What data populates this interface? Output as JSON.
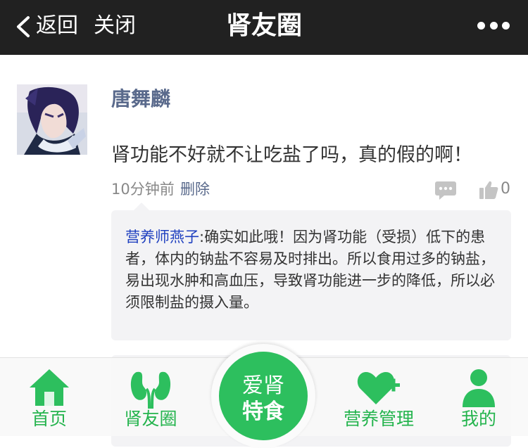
{
  "nav": {
    "back_label": "返回",
    "close_label": "关闭",
    "title": "肾友圈"
  },
  "post": {
    "author": "唐舞麟",
    "text": "肾功能不好就不让吃盐了吗，真的假的啊！",
    "time": "10分钟前",
    "delete_label": "删除",
    "like_count": "0"
  },
  "comments": [
    {
      "author": "营养师燕子",
      "separator": ":",
      "text": "确实如此哦！因为肾功能（受损）低下的患者，体内的钠盐不容易及时排出。所以食用过多的钠盐，易出现水肿和高血压，导致肾功能进一步的降低，所以必须限制盐的摄入量。"
    }
  ],
  "tabs": [
    {
      "label": "首页",
      "icon": "home-icon"
    },
    {
      "label": "肾友圈",
      "icon": "kidney-icon"
    },
    {
      "label": "营养管理",
      "icon": "heart-plus-icon"
    },
    {
      "label": "我的",
      "icon": "user-icon"
    }
  ],
  "center_button": {
    "line1": "爱肾",
    "line2": "特食"
  },
  "colors": {
    "topbar": "#212121",
    "accent_green": "#2dbf5e",
    "tab_green": "#25b44e",
    "author_blue_gray": "#5a6a8c",
    "commenter_blue": "#1e3fbf",
    "comment_bg": "#f3f3f5"
  }
}
